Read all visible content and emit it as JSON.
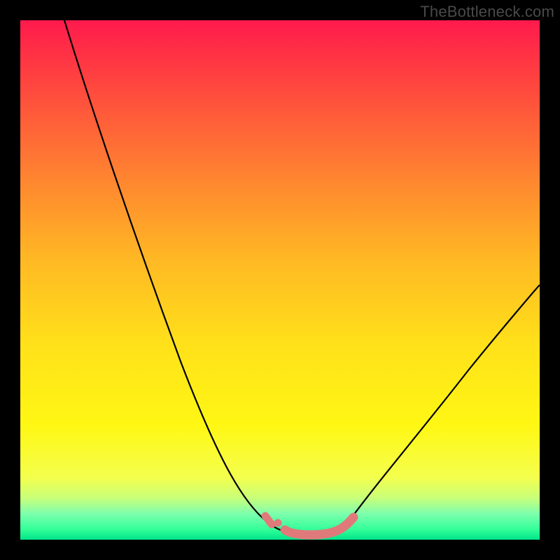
{
  "watermark": "TheBottleneck.com",
  "chart_data": {
    "type": "line",
    "title": "",
    "xlabel": "",
    "ylabel": "",
    "xlim": [
      0,
      100
    ],
    "ylim": [
      0,
      100
    ],
    "series": [
      {
        "name": "bottleneck-curve",
        "x": [
          0,
          5,
          10,
          15,
          20,
          25,
          30,
          35,
          40,
          45,
          49,
          53,
          57,
          62,
          70,
          80,
          90,
          100
        ],
        "values": [
          100,
          90,
          80,
          70,
          60,
          50,
          40,
          30,
          20,
          10,
          4,
          2,
          2,
          4,
          12,
          25,
          40,
          55
        ]
      }
    ],
    "annotations": [
      {
        "name": "valley-highlight",
        "x_start": 47,
        "x_end": 63,
        "y": 2,
        "color": "#e07a7a"
      }
    ]
  },
  "colors": {
    "curve": "#000000",
    "highlight": "#e07a7a",
    "gradient_top": "#ff1a4d",
    "gradient_bottom": "#00e58a",
    "frame": "#000000"
  }
}
